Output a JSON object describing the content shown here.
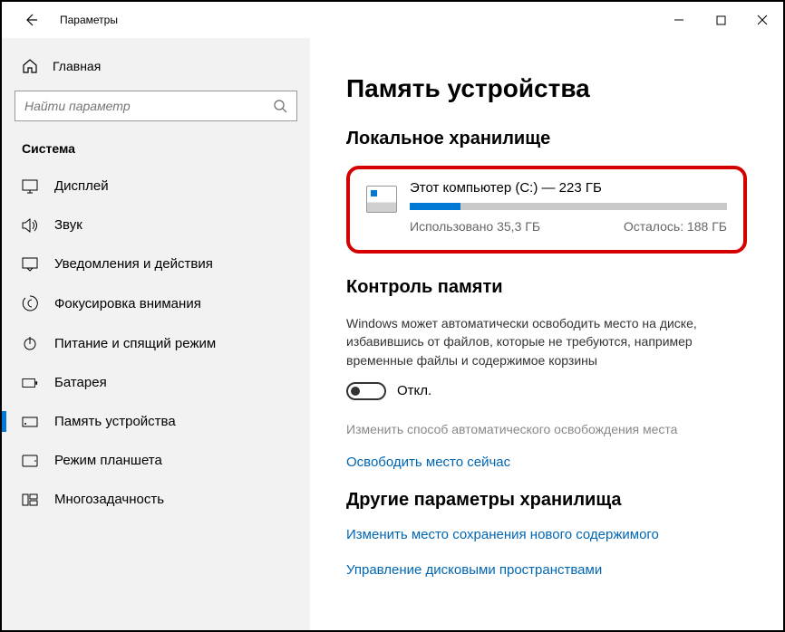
{
  "window": {
    "title": "Параметры"
  },
  "sidebar": {
    "home": "Главная",
    "search_placeholder": "Найти параметр",
    "section": "Система",
    "items": [
      {
        "label": "Дисплей",
        "icon": "display"
      },
      {
        "label": "Звук",
        "icon": "sound"
      },
      {
        "label": "Уведомления и действия",
        "icon": "notifications"
      },
      {
        "label": "Фокусировка внимания",
        "icon": "focus"
      },
      {
        "label": "Питание и спящий режим",
        "icon": "power"
      },
      {
        "label": "Батарея",
        "icon": "battery"
      },
      {
        "label": "Память устройства",
        "icon": "storage",
        "active": true
      },
      {
        "label": "Режим планшета",
        "icon": "tablet"
      },
      {
        "label": "Многозадачность",
        "icon": "multitask"
      }
    ]
  },
  "main": {
    "title": "Память устройства",
    "local_storage_heading": "Локальное хранилище",
    "disk": {
      "title": "Этот компьютер (C:) — 223 ГБ",
      "used": "Использовано 35,3 ГБ",
      "remaining": "Осталось: 188 ГБ",
      "fill_percent": 16
    },
    "sense_heading": "Контроль памяти",
    "sense_desc": "Windows может автоматически освободить место на диске, избавившись от файлов, которые не требуются, например временные файлы и содержимое корзины",
    "toggle_label": "Откл.",
    "change_link": "Изменить способ автоматического освобождения места",
    "free_now_link": "Освободить место сейчас",
    "other_heading": "Другие параметры хранилища",
    "change_location_link": "Изменить место сохранения нового содержимого",
    "manage_spaces_link": "Управление дисковыми пространствами"
  }
}
